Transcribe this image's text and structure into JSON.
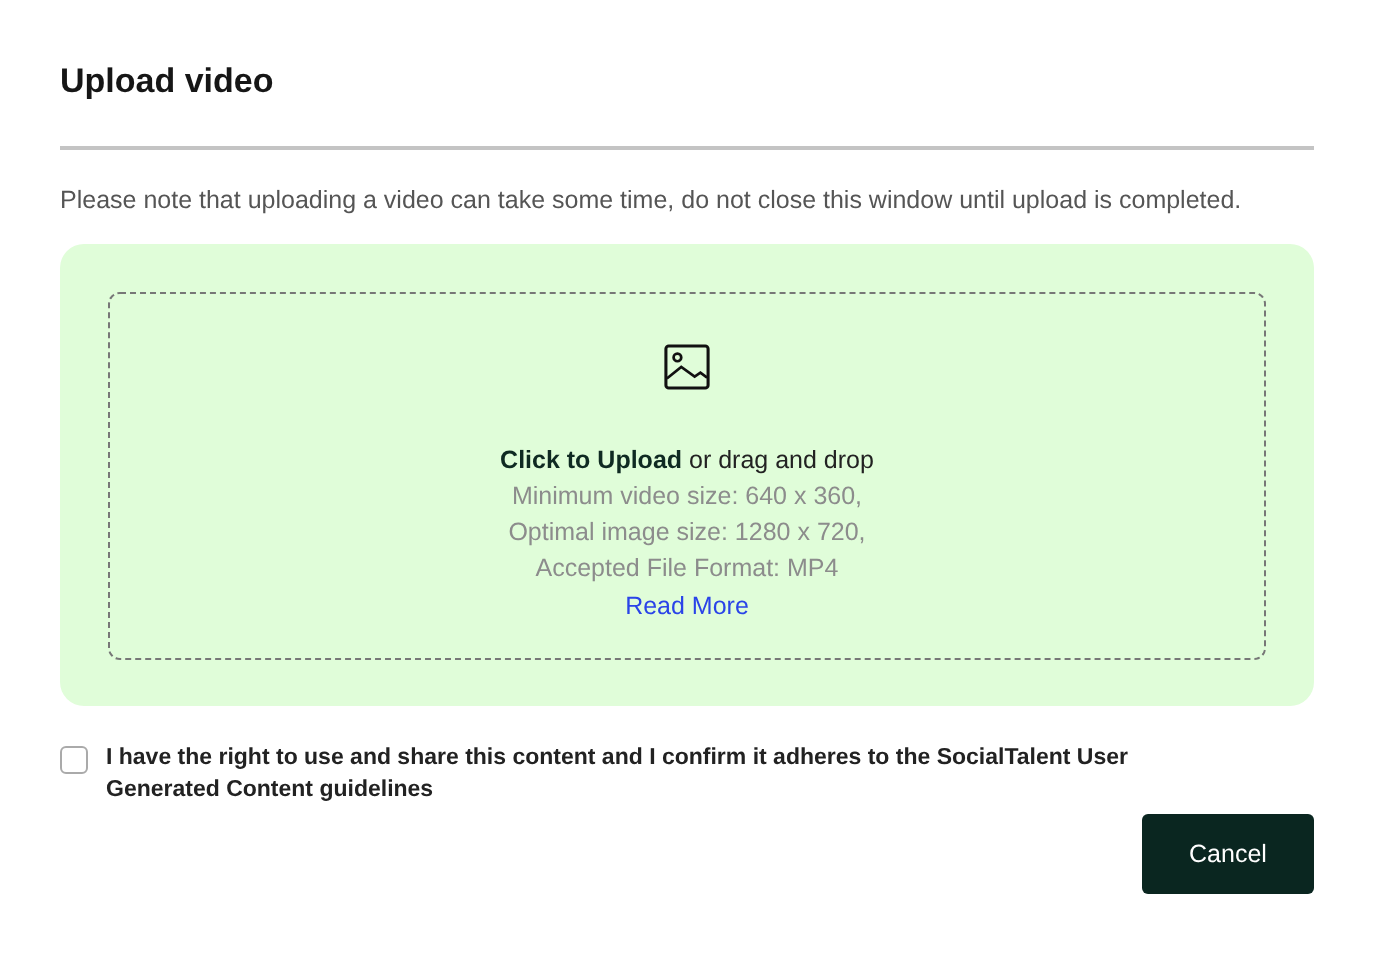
{
  "dialog": {
    "title": "Upload video"
  },
  "note": "Please note that uploading a video can take some time, do not close this window until upload is completed.",
  "dropzone": {
    "prompt": "**Click to Upload** or drag and drop",
    "requirements": [
      "Minimum video size: 640 x 360,",
      "Optimal image size: 1280 x 720,",
      "Accepted File Format: MP4"
    ],
    "link": "Read More"
  },
  "consent": {
    "label": "I have the right to use and share this content and I confirm it adheres to the SocialTalent User Generated Content guidelines",
    "checked": false
  },
  "buttons": [
    "Cancel"
  ]
}
